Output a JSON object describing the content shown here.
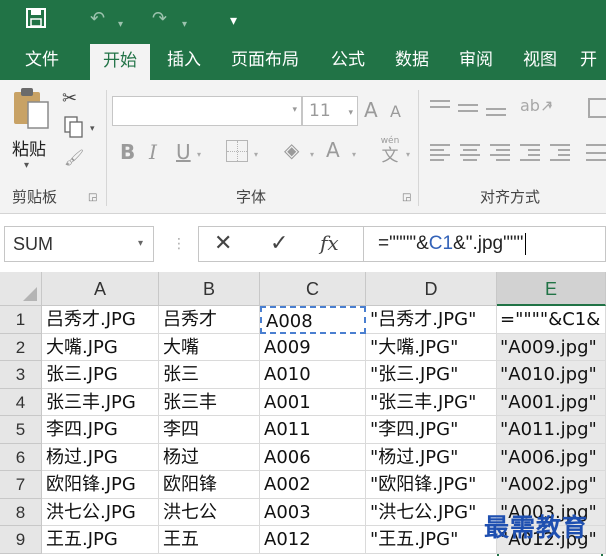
{
  "quick_access": {
    "save_icon": "save-icon",
    "undo_icon": "undo-icon",
    "redo_icon": "redo-icon",
    "customize_icon": "customize-icon"
  },
  "ribbon_tabs": [
    "文件",
    "开始",
    "插入",
    "页面布局",
    "公式",
    "数据",
    "审阅",
    "视图",
    "开"
  ],
  "active_tab": "开始",
  "clipboard": {
    "paste_label": "粘贴",
    "group_label": "剪贴板"
  },
  "font_group": {
    "font_name": "",
    "font_size": "11",
    "grow_label": "A",
    "shrink_label": "A",
    "bold_label": "B",
    "italic_label": "I",
    "underline_label": "U",
    "font_color_label": "A",
    "phonetic_top": "wén",
    "phonetic_bottom": "文",
    "group_label": "字体"
  },
  "alignment": {
    "group_label": "对齐方式"
  },
  "formula_bar": {
    "name_box": "SUM",
    "cancel_label": "✕",
    "enter_label": "✓",
    "fx_label": "fx",
    "formula_before": "=\"\"\"\"&",
    "formula_ref": "C1",
    "formula_after": "&\".jpg\"\"\""
  },
  "grid": {
    "columns": [
      "A",
      "B",
      "C",
      "D",
      "E"
    ],
    "selected_column": "E",
    "rows": [
      {
        "num": "1",
        "a": "吕秀才.JPG",
        "b": "吕秀才",
        "c": "A008",
        "d": "\"吕秀才.JPG\"",
        "e": "=\"\"\"\"&C1&"
      },
      {
        "num": "2",
        "a": "大嘴.JPG",
        "b": "大嘴",
        "c": "A009",
        "d": "\"大嘴.JPG\"",
        "e": "\"A009.jpg\""
      },
      {
        "num": "3",
        "a": "张三.JPG",
        "b": "张三",
        "c": "A010",
        "d": "\"张三.JPG\"",
        "e": "\"A010.jpg\""
      },
      {
        "num": "4",
        "a": "张三丰.JPG",
        "b": "张三丰",
        "c": "A001",
        "d": "\"张三丰.JPG\"",
        "e": "\"A001.jpg\""
      },
      {
        "num": "5",
        "a": "李四.JPG",
        "b": "李四",
        "c": "A011",
        "d": "\"李四.JPG\"",
        "e": "\"A011.jpg\""
      },
      {
        "num": "6",
        "a": "杨过.JPG",
        "b": "杨过",
        "c": "A006",
        "d": "\"杨过.JPG\"",
        "e": "\"A006.jpg\""
      },
      {
        "num": "7",
        "a": "欧阳锋.JPG",
        "b": "欧阳锋",
        "c": "A002",
        "d": "\"欧阳锋.JPG\"",
        "e": "\"A002.jpg\""
      },
      {
        "num": "8",
        "a": "洪七公.JPG",
        "b": "洪七公",
        "c": "A003",
        "d": "\"洪七公.JPG\"",
        "e": "\"A003.jpg\""
      },
      {
        "num": "9",
        "a": "王五.JPG",
        "b": "王五",
        "c": "A012",
        "d": "\"王五.JPG\"",
        "e": "\"A012.jpg\""
      }
    ]
  },
  "watermark": "最需教育",
  "colors": {
    "excel_green": "#217346",
    "ribbon_bg": "#f3f3f3",
    "reference_blue": "#3362b8"
  }
}
